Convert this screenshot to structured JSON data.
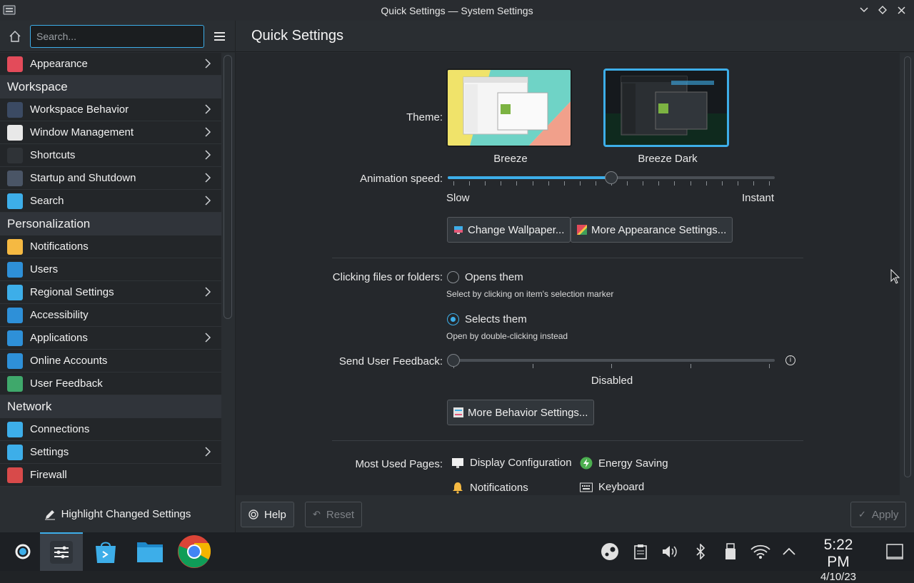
{
  "window": {
    "title": "Quick Settings — System Settings"
  },
  "sidebar": {
    "search_placeholder": "Search...",
    "groups": [
      {
        "items": [
          {
            "label": "Appearance",
            "icon": "appearance-icon",
            "chevron": true
          }
        ]
      },
      {
        "category": "Workspace",
        "items": [
          {
            "label": "Workspace Behavior",
            "icon": "workspace-behavior-icon",
            "chevron": true
          },
          {
            "label": "Window Management",
            "icon": "window-management-icon",
            "chevron": true
          },
          {
            "label": "Shortcuts",
            "icon": "keyboard-icon",
            "chevron": true
          },
          {
            "label": "Startup and Shutdown",
            "icon": "startup-icon",
            "chevron": true
          },
          {
            "label": "Search",
            "icon": "search-icon",
            "chevron": true
          }
        ]
      },
      {
        "category": "Personalization",
        "items": [
          {
            "label": "Notifications",
            "icon": "bell-icon",
            "chevron": false
          },
          {
            "label": "Users",
            "icon": "users-icon",
            "chevron": false
          },
          {
            "label": "Regional Settings",
            "icon": "regional-icon",
            "chevron": true
          },
          {
            "label": "Accessibility",
            "icon": "accessibility-icon",
            "chevron": false
          },
          {
            "label": "Applications",
            "icon": "applications-icon",
            "chevron": true
          },
          {
            "label": "Online Accounts",
            "icon": "online-accounts-icon",
            "chevron": false
          },
          {
            "label": "User Feedback",
            "icon": "user-feedback-icon",
            "chevron": false
          }
        ]
      },
      {
        "category": "Network",
        "items": [
          {
            "label": "Connections",
            "icon": "globe-icon",
            "chevron": false
          },
          {
            "label": "Settings",
            "icon": "globe-icon",
            "chevron": true
          },
          {
            "label": "Firewall",
            "icon": "firewall-icon",
            "chevron": false
          }
        ]
      }
    ],
    "highlight_label": "Highlight Changed Settings"
  },
  "main": {
    "page_title": "Quick Settings",
    "theme": {
      "label": "Theme:",
      "options": [
        {
          "name": "Breeze",
          "selected": false
        },
        {
          "name": "Breeze Dark",
          "selected": true
        }
      ]
    },
    "animation": {
      "label": "Animation speed:",
      "min_label": "Slow",
      "max_label": "Instant",
      "value": 0.5
    },
    "change_wallpaper": "Change Wallpaper...",
    "more_appearance": "More Appearance Settings...",
    "clicking": {
      "label": "Clicking files or folders:",
      "opt1": "Opens them",
      "opt1_hint": "Select by clicking on item's selection marker",
      "opt2": "Selects them",
      "opt2_hint": "Open by double-clicking instead",
      "selected": 2
    },
    "feedback": {
      "label": "Send User Feedback:",
      "value_label": "Disabled",
      "value": 0
    },
    "more_behavior": "More Behavior Settings...",
    "most_used": {
      "label": "Most Used Pages:",
      "pages": [
        "Display Configuration",
        "Energy Saving",
        "Notifications",
        "Keyboard"
      ]
    }
  },
  "footer": {
    "help": "Help",
    "reset": "Reset",
    "apply": "Apply"
  },
  "taskbar": {
    "time": "5:22 PM",
    "date": "4/10/23"
  },
  "colors": {
    "accent": "#3daee9",
    "bg": "#2a2e32"
  }
}
